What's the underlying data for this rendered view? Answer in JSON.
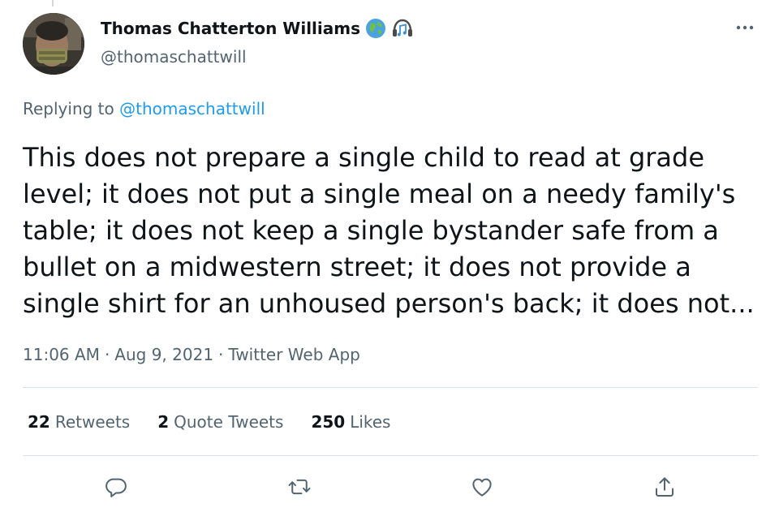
{
  "author": {
    "display_name": "Thomas Chatterton Williams",
    "handle": "@thomaschattwill",
    "badges": [
      "globe-emoji",
      "headphones-music-emoji"
    ]
  },
  "reply": {
    "prefix": "Replying to",
    "to": "@thomaschattwill"
  },
  "tweet": {
    "text": "This does not prepare a single child to read at grade level; it does not put a single meal on a needy family's table; it does not keep a single bystander safe from a bullet on a midwestern street; it does not provide a single shirt for an unhoused person's back; it does not...",
    "time": "11:06 AM",
    "separator": "·",
    "date": "Aug 9, 2021",
    "source": "Twitter Web App"
  },
  "stats": {
    "retweets_count": "22",
    "retweets_label": "Retweets",
    "quotes_count": "2",
    "quotes_label": "Quote Tweets",
    "likes_count": "250",
    "likes_label": "Likes"
  },
  "actions": [
    "reply-icon",
    "retweet-icon",
    "like-icon",
    "share-icon"
  ],
  "colors": {
    "link": "#1d9bf0",
    "secondary_text": "#536471",
    "primary_text": "#0f1419",
    "divider": "#dbe2e6"
  }
}
